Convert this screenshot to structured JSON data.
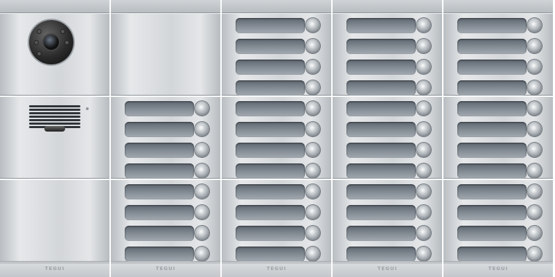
{
  "panel": {
    "brand_text": "TEGUI",
    "colors": {
      "housing": "#d3d6d9",
      "label_window": "#7e868f",
      "button": "#c8cdd1",
      "grille": "#2e3338",
      "camera": "#1a1a1a"
    },
    "columns": [
      {
        "modules": [
          "camera",
          "speaker",
          "blank"
        ]
      },
      {
        "modules": [
          "blank",
          "buttons-4",
          "buttons-4"
        ]
      },
      {
        "modules": [
          "buttons-4",
          "buttons-4",
          "buttons-4"
        ]
      },
      {
        "modules": [
          "buttons-4",
          "buttons-4",
          "buttons-4"
        ]
      },
      {
        "modules": [
          "buttons-4",
          "buttons-4",
          "buttons-4"
        ]
      }
    ],
    "call_button_count": 44
  }
}
